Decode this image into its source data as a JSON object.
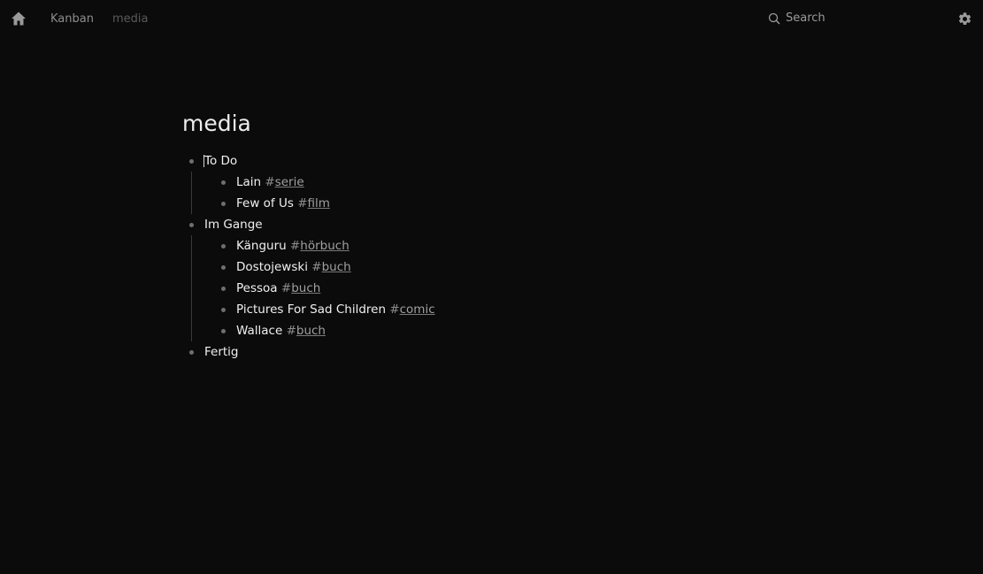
{
  "topbar": {
    "breadcrumbs": [
      "Kanban",
      "media"
    ],
    "search_label": "Search"
  },
  "icons": {
    "home": "home-icon",
    "search": "search-icon",
    "settings": "gear-icon"
  },
  "page": {
    "title": "media"
  },
  "outline": [
    {
      "label": "To Do",
      "children": [
        {
          "label": "Lain",
          "hash": "#",
          "tag": "serie"
        },
        {
          "label": "Few of Us",
          "hash": "#",
          "tag": "film"
        }
      ]
    },
    {
      "label": "Im Gange",
      "children": [
        {
          "label": "Känguru",
          "hash": "#",
          "tag": "hörbuch"
        },
        {
          "label": "Dostojewski",
          "hash": "#",
          "tag": "buch"
        },
        {
          "label": "Pessoa",
          "hash": "#",
          "tag": "buch"
        },
        {
          "label": "Pictures For Sad Children",
          "hash": "#",
          "tag": "comic"
        },
        {
          "label": "Wallace",
          "hash": "#",
          "tag": "buch"
        }
      ]
    },
    {
      "label": "Fertig",
      "children": []
    }
  ],
  "colors": {
    "background": "#0b0b0b",
    "text": "#f0f0f0",
    "muted": "#8d8d8d",
    "bullet": "#6f6f6f"
  }
}
